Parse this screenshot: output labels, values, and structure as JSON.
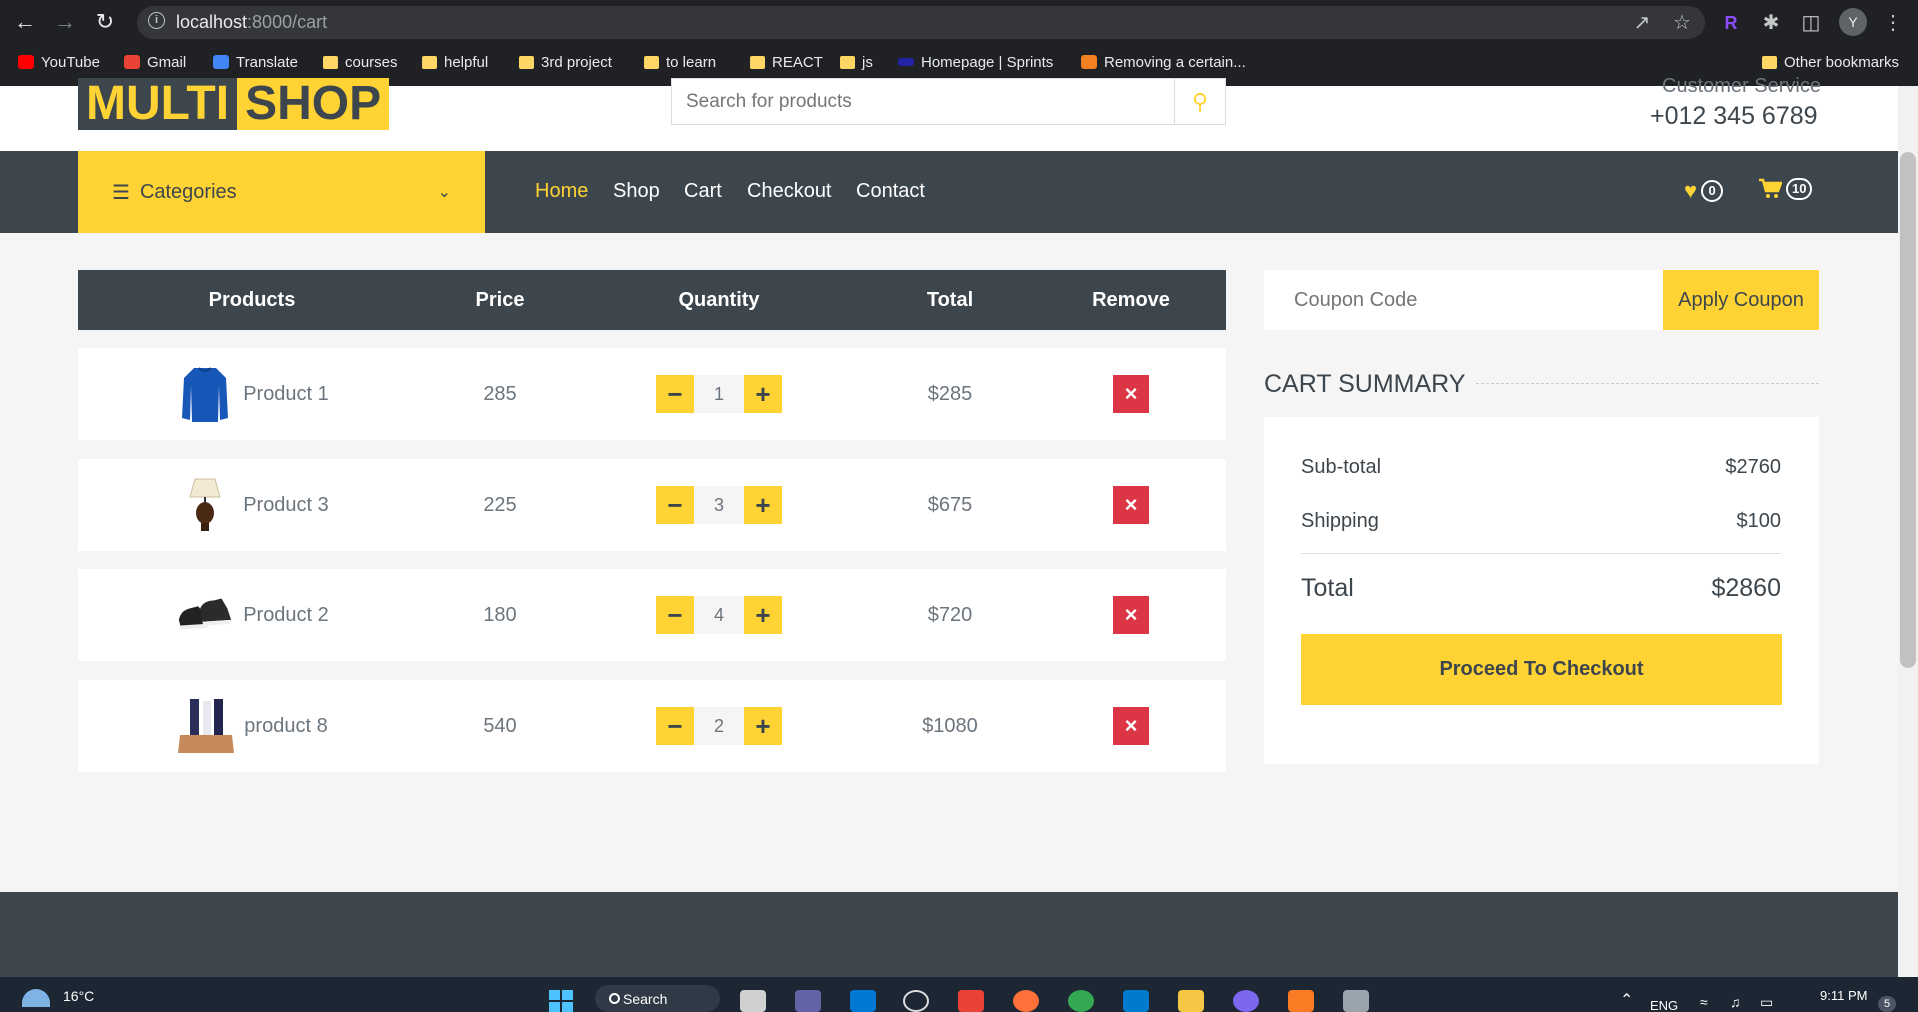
{
  "browser": {
    "url_host": "localhost",
    "url_path": ":8000/cart",
    "avatar_letter": "Y",
    "extension_letter": "R",
    "bookmarks": [
      {
        "label": "YouTube",
        "icon": "youtube-icon",
        "color": "#ff0000"
      },
      {
        "label": "Gmail",
        "icon": "gmail-icon",
        "color": "#ea4335"
      },
      {
        "label": "Translate",
        "icon": "translate-icon",
        "color": "#4285f4"
      },
      {
        "label": "courses",
        "icon": "folder-icon",
        "color": "#fdd663"
      },
      {
        "label": "helpful",
        "icon": "folder-icon",
        "color": "#fdd663"
      },
      {
        "label": "3rd project",
        "icon": "folder-icon",
        "color": "#fdd663"
      },
      {
        "label": "to learn",
        "icon": "folder-icon",
        "color": "#fdd663"
      },
      {
        "label": "REACT",
        "icon": "folder-icon",
        "color": "#fdd663"
      },
      {
        "label": "js",
        "icon": "folder-icon",
        "color": "#fdd663"
      },
      {
        "label": "Homepage | Sprints",
        "icon": "sprints-icon",
        "color": "#2323a8"
      },
      {
        "label": "Removing a certain...",
        "icon": "stackoverflow-icon",
        "color": "#f48024"
      }
    ],
    "other_bookmarks": "Other bookmarks"
  },
  "header": {
    "logo_part1": "MULTI",
    "logo_part2": "SHOP",
    "search_placeholder": "Search for products",
    "customer_service": "Customer Service",
    "phone": "+012 345 6789"
  },
  "nav": {
    "categories": "Categories",
    "links": [
      "Home",
      "Shop",
      "Cart",
      "Checkout",
      "Contact"
    ],
    "wishlist_count": "0",
    "cart_count": "10"
  },
  "cart": {
    "headers": [
      "Products",
      "Price",
      "Quantity",
      "Total",
      "Remove"
    ],
    "items": [
      {
        "name": "Product 1",
        "price": "285",
        "qty": "1",
        "total": "$285",
        "icon": "sweater-icon"
      },
      {
        "name": "Product 3",
        "price": "225",
        "qty": "3",
        "total": "$675",
        "icon": "lamp-icon"
      },
      {
        "name": "Product 2",
        "price": "180",
        "qty": "4",
        "total": "$720",
        "icon": "shoes-icon"
      },
      {
        "name": "product 8",
        "price": "540",
        "qty": "2",
        "total": "$1080",
        "icon": "cosmetics-icon"
      }
    ]
  },
  "coupon": {
    "placeholder": "Coupon Code",
    "button": "Apply Coupon"
  },
  "summary": {
    "title": "CART SUMMARY",
    "subtotal_label": "Sub-total",
    "subtotal": "$2760",
    "shipping_label": "Shipping",
    "shipping": "$100",
    "total_label": "Total",
    "total": "$2860",
    "checkout": "Proceed To Checkout"
  },
  "taskbar": {
    "temp": "16°C",
    "search": "Search",
    "lang": "ENG",
    "time": "9:11 PM",
    "notif_count": "5"
  },
  "colors": {
    "primary": "#ffd333",
    "dark": "#3d464d",
    "danger": "#dc3545"
  }
}
